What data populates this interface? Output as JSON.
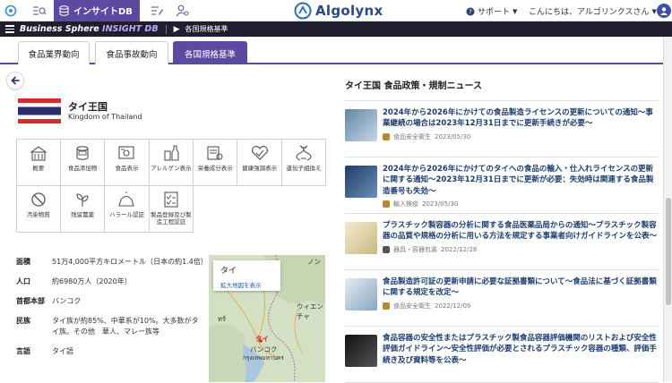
{
  "topbar": {
    "insight_label": "インサイトDB",
    "logo_text": "Algolynx",
    "support_label": "サポート",
    "greeting": "こんにちは、アルゴリンクスさん"
  },
  "navbar": {
    "brand_main": "Business Sphere",
    "brand_accent": "INSIGHT DB",
    "breadcrumb": "各国規格基準"
  },
  "tabs": [
    {
      "label": "食品業界動向"
    },
    {
      "label": "食品事故動向"
    },
    {
      "label": "各国規格基準"
    }
  ],
  "country": {
    "name": "タイ王国",
    "name_en": "Kingdom of Thailand"
  },
  "categories": [
    {
      "label": "概要",
      "icon": "building-icon"
    },
    {
      "label": "食品添加物",
      "icon": "can-icon"
    },
    {
      "label": "食品表示",
      "icon": "label-icon"
    },
    {
      "label": "アレルゲン表示",
      "icon": "bottle-icon"
    },
    {
      "label": "栄養成分表示",
      "icon": "nutrition-icon"
    },
    {
      "label": "健康強調表示",
      "icon": "heart-icon"
    },
    {
      "label": "遺伝子組換え",
      "icon": "dna-icon"
    },
    {
      "label": "汚染物質",
      "icon": "prohibit-icon"
    },
    {
      "label": "残留農薬",
      "icon": "sprout-icon"
    },
    {
      "label": "ハラール認証",
      "icon": "halal-icon"
    },
    {
      "label": "製品登録及び製造工程認証",
      "icon": "checklist-icon"
    }
  ],
  "info": [
    {
      "key": "面積",
      "value": "51万4,000平方キロメートル（日本の約1.4倍）"
    },
    {
      "key": "人口",
      "value": "約6980万人（2020年）"
    },
    {
      "key": "首都本部",
      "value": "バンコク"
    },
    {
      "key": "民族",
      "value": "タイ族が約85%、中華系が10%。大多数がタイ族。その他　華人、マレー族等"
    },
    {
      "key": "言語",
      "value": "タイ語"
    }
  ],
  "map": {
    "popup_name": "タイ",
    "popup_link": "拡大地図を表示",
    "labels": [
      "ノン",
      "ウィエンチャ",
      "ทร์",
      "タイ",
      "バンコク",
      "กรุงเทพมหานคร"
    ]
  },
  "news": {
    "section_title": "タイ王国 食品政策・規制ニュース",
    "items": [
      {
        "headline": "2024年から2026年にかけての食品製造ライセンスの更新についての通知〜事業継続の場合は2023年12月31日までに更新手続きが必要〜",
        "category": "食品安全衛生",
        "date": "2023/05/30",
        "thumb_color": "#8fa8c0"
      },
      {
        "headline": "2024年から2026年にかけてのタイへの食品の輸入・仕入れライセンスの更新に関する通知〜2023年12月31日までに更新が必要：失効時は関連する食品製造番号も失効〜",
        "category": "輸入検疫",
        "date": "2023/05/30",
        "thumb_color": "#3a5f8f"
      },
      {
        "headline": "プラスチック製容器の分析に関する食品医薬品局からの通知〜プラスチック製容器の品質や規格の分析に用いる方法を規定する事業者向けガイドラインを公表〜",
        "category": "器具・容器包装",
        "date": "2022/12/28",
        "thumb_color": "#d9cfa8"
      },
      {
        "headline": "食品製造許可証の更新申請に必要な証拠書類について〜食品法に基づく証拠書類に関する規定を改定〜",
        "category": "食品安全衛生",
        "date": "2022/12/09",
        "thumb_color": "#a9c1d6"
      },
      {
        "headline": "食品容器の安全性またはプラスチック製食品容器評価機関のリストおよび安全性評価ガイドライン〜安全性評価が必要とされるプラスチック容器の種類、評価手続き及び資料等を公表〜",
        "category": "",
        "date": "",
        "thumb_color": "#222222"
      }
    ]
  }
}
